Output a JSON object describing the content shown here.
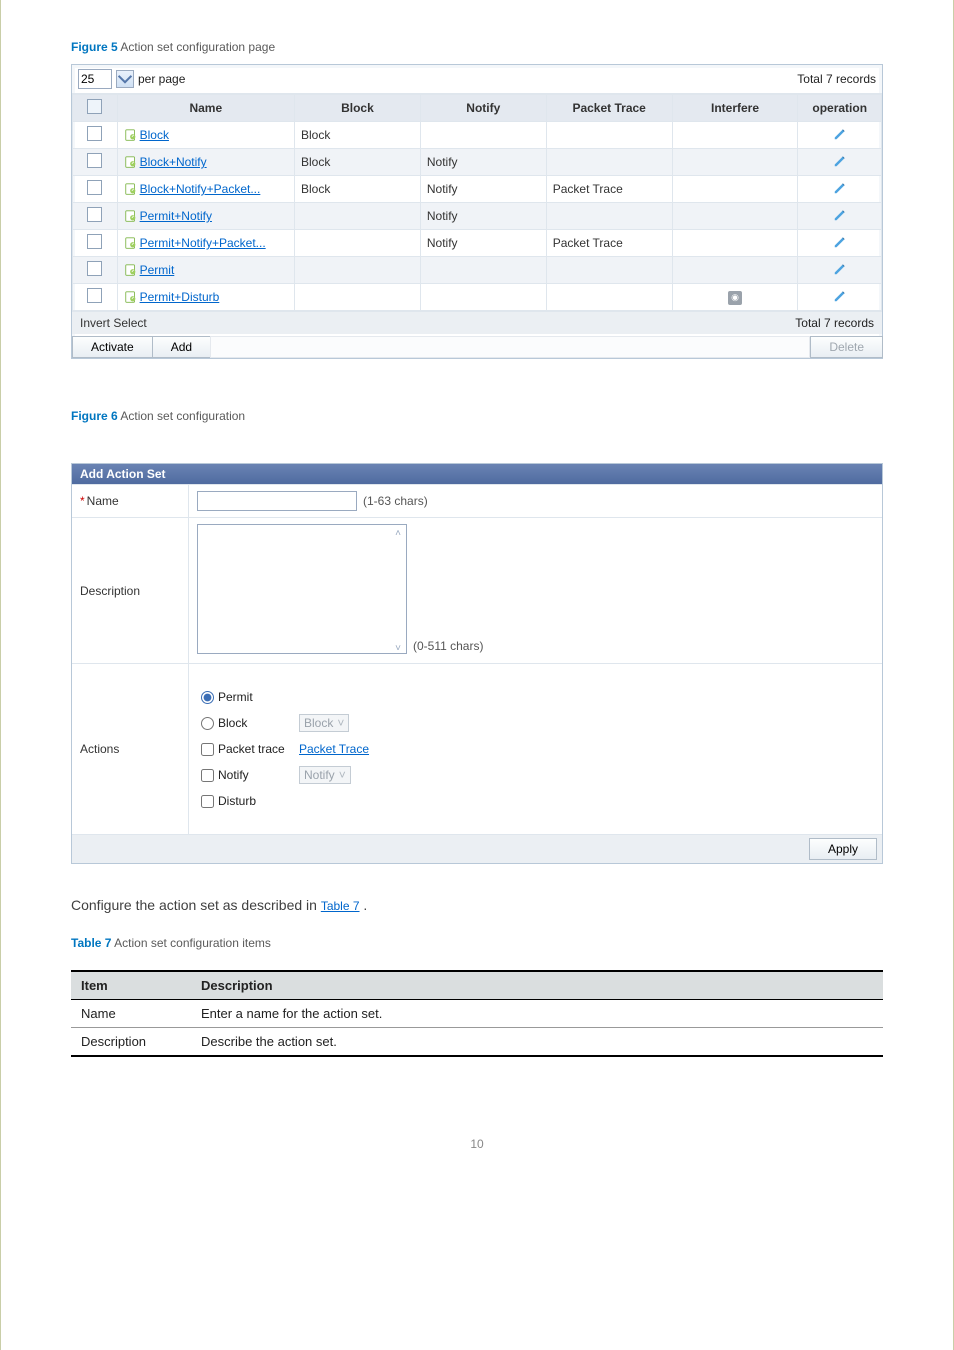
{
  "fig5": {
    "label_prefix": "Figure 5",
    "label_text": "Action set configuration page"
  },
  "fig6": {
    "label_prefix": "Figure 6",
    "label_text": "Action set configuration"
  },
  "grid": {
    "per_page_value": "25",
    "per_page_label": "per page",
    "total_top": "Total 7 records",
    "headers": {
      "name": "Name",
      "block": "Block",
      "notify": "Notify",
      "packet": "Packet Trace",
      "interfere": "Interfere",
      "operation": "operation"
    },
    "rows": [
      {
        "name": "Block",
        "block": "Block",
        "notify": "",
        "packet": "",
        "interfere": ""
      },
      {
        "name": "Block+Notify",
        "block": "Block",
        "notify": "Notify",
        "packet": "",
        "interfere": ""
      },
      {
        "name": "Block+Notify+Packet...",
        "block": "Block",
        "notify": "Notify",
        "packet": "Packet Trace",
        "interfere": ""
      },
      {
        "name": "Permit+Notify",
        "block": "",
        "notify": "Notify",
        "packet": "",
        "interfere": ""
      },
      {
        "name": "Permit+Notify+Packet...",
        "block": "",
        "notify": "Notify",
        "packet": "Packet Trace",
        "interfere": ""
      },
      {
        "name": "Permit",
        "block": "",
        "notify": "",
        "packet": "",
        "interfere": ""
      },
      {
        "name": "Permit+Disturb",
        "block": "",
        "notify": "",
        "packet": "",
        "interfere": "icon"
      }
    ],
    "invert_select": "Invert Select",
    "total_bottom": "Total 7 records",
    "activate": "Activate",
    "add": "Add",
    "delete": "Delete"
  },
  "addset": {
    "title": "Add Action Set",
    "name_label": "Name",
    "name_hint": "(1-63  chars)",
    "description_label": "Description",
    "description_hint": "(0-511  chars)",
    "actions_label": "Actions",
    "permit": "Permit",
    "block": "Block",
    "block_select": "Block",
    "packet_trace_label": "Packet trace",
    "packet_trace_link": "Packet Trace",
    "notify_label": "Notify",
    "notify_select": "Notify",
    "disturb": "Disturb",
    "apply": "Apply"
  },
  "body": {
    "para1_a": "Configure the action set as described in ",
    "para1_link": "Table 7",
    "para1_b": "."
  },
  "table7": {
    "caption_prefix": "Table 7",
    "caption_text": "Action set configuration items",
    "head_item": "Item",
    "head_desc": "Description",
    "rows": [
      {
        "item": "Name",
        "desc": "Enter a name for the action set."
      },
      {
        "item": "Description",
        "desc": "Describe the action set."
      }
    ]
  },
  "page_num": "10"
}
